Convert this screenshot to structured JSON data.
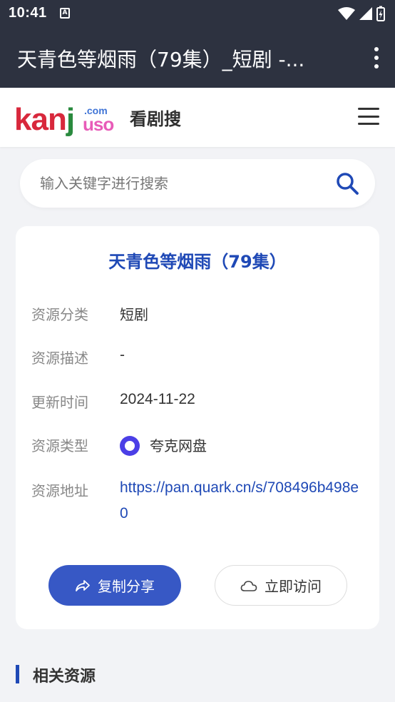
{
  "status_bar": {
    "time": "10:41",
    "notification_icon": "A"
  },
  "app_bar": {
    "title": "天青色等烟雨（79集）_短剧 -..."
  },
  "header": {
    "logo": {
      "main": "kan",
      "j": "j",
      "uso": "uso",
      "com": ".com"
    },
    "site_name": "看剧搜"
  },
  "search": {
    "placeholder": "输入关键字进行搜索",
    "value": ""
  },
  "resource": {
    "title": "天青色等烟雨（79集）",
    "fields": [
      {
        "label": "资源分类",
        "value": "短剧"
      },
      {
        "label": "资源描述",
        "value": "-"
      },
      {
        "label": "更新时间",
        "value": "2024-11-22"
      },
      {
        "label": "资源类型",
        "value": "夸克网盘"
      },
      {
        "label": "资源地址",
        "value": "https://pan.quark.cn/s/708496b498e0"
      }
    ],
    "share_label": "复制分享",
    "visit_label": "立即访问"
  },
  "related": {
    "title": "相关资源"
  },
  "colors": {
    "accent": "#1f49b6",
    "button": "#3758c5",
    "topbar": "#2d3240",
    "quark": "#4b3fe6"
  }
}
